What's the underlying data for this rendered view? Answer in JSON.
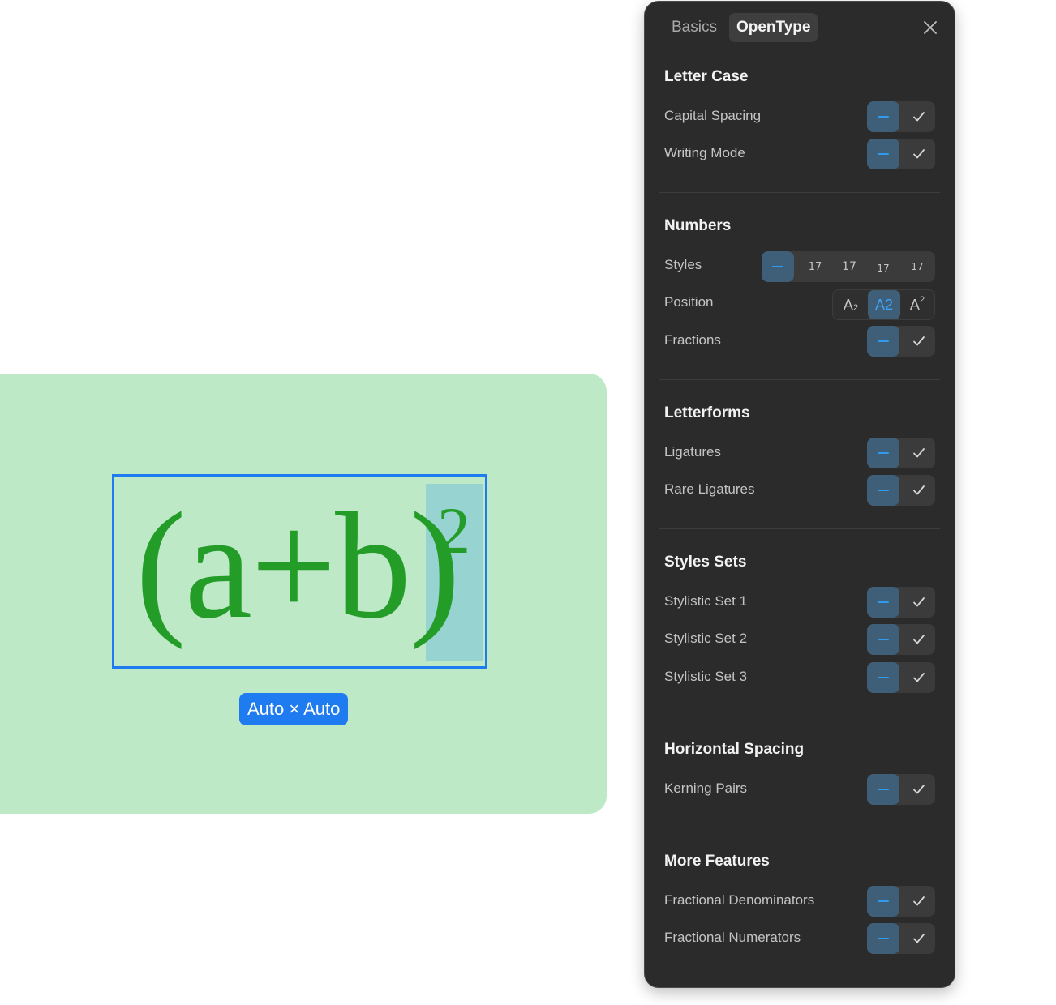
{
  "canvas": {
    "formula": "(a+b)",
    "superscript": "2",
    "size_badge": "Auto × Auto"
  },
  "panel": {
    "tabs": [
      {
        "label": "Basics",
        "active": false
      },
      {
        "label": "OpenType",
        "active": true
      }
    ],
    "close_icon": "close-icon",
    "sections": {
      "letter_case": {
        "title": "Letter Case",
        "rows": [
          "Capital Spacing",
          "Writing Mode"
        ]
      },
      "numbers": {
        "title": "Numbers",
        "styles_label": "Styles",
        "styles_options": [
          "17",
          "17",
          "17",
          "17"
        ],
        "position_label": "Position",
        "position_options": {
          "subscript_base": "A",
          "subscript_mark": "2",
          "normal": "A2",
          "superscript_base": "A",
          "superscript_mark": "2"
        },
        "position_selected": "A2",
        "fractions_label": "Fractions"
      },
      "letterforms": {
        "title": "Letterforms",
        "rows": [
          "Ligatures",
          "Rare Ligatures"
        ]
      },
      "styles_sets": {
        "title": "Styles Sets",
        "rows": [
          "Stylistic Set 1",
          "Stylistic Set 2",
          "Stylistic Set 3"
        ]
      },
      "horizontal_spacing": {
        "title": "Horizontal Spacing",
        "rows": [
          "Kerning Pairs"
        ]
      },
      "more_features": {
        "title": "More Features",
        "rows": [
          "Fractional Denominators",
          "Fractional Numerators"
        ]
      }
    }
  },
  "colors": {
    "accent": "#1f7bf0",
    "formula_green": "#249d28",
    "canvas_bg": "#bde9c6",
    "panel_bg": "#2b2b2b",
    "toggle_off_bg": "#3f5f78",
    "toggle_dash": "#2e9bf0"
  }
}
